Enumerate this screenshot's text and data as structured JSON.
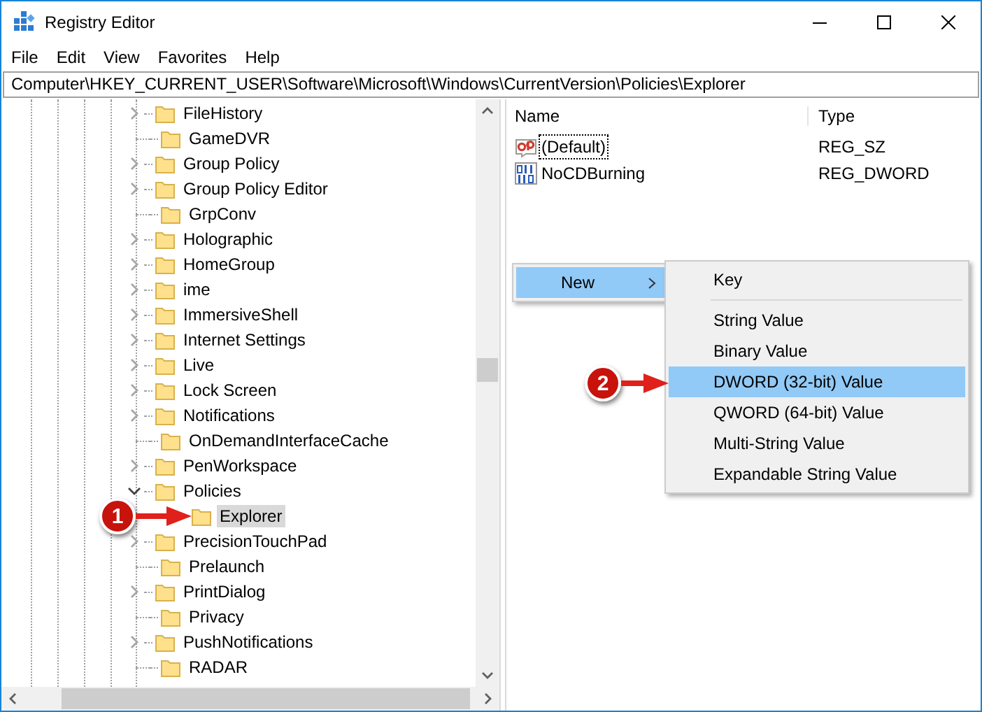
{
  "window": {
    "title": "Registry Editor"
  },
  "menu": [
    "File",
    "Edit",
    "View",
    "Favorites",
    "Help"
  ],
  "address": "Computer\\HKEY_CURRENT_USER\\Software\\Microsoft\\Windows\\CurrentVersion\\Policies\\Explorer",
  "tree": [
    {
      "name": "FileHistory",
      "has_children": true,
      "expanded": false,
      "selected": false
    },
    {
      "name": "GameDVR",
      "has_children": false,
      "expanded": false,
      "selected": false
    },
    {
      "name": "Group Policy",
      "has_children": true,
      "expanded": false,
      "selected": false
    },
    {
      "name": "Group Policy Editor",
      "has_children": true,
      "expanded": false,
      "selected": false
    },
    {
      "name": "GrpConv",
      "has_children": false,
      "expanded": false,
      "selected": false
    },
    {
      "name": "Holographic",
      "has_children": true,
      "expanded": false,
      "selected": false
    },
    {
      "name": "HomeGroup",
      "has_children": true,
      "expanded": false,
      "selected": false
    },
    {
      "name": "ime",
      "has_children": true,
      "expanded": false,
      "selected": false
    },
    {
      "name": "ImmersiveShell",
      "has_children": true,
      "expanded": false,
      "selected": false
    },
    {
      "name": "Internet Settings",
      "has_children": true,
      "expanded": false,
      "selected": false
    },
    {
      "name": "Live",
      "has_children": true,
      "expanded": false,
      "selected": false
    },
    {
      "name": "Lock Screen",
      "has_children": true,
      "expanded": false,
      "selected": false
    },
    {
      "name": "Notifications",
      "has_children": true,
      "expanded": false,
      "selected": false
    },
    {
      "name": "OnDemandInterfaceCache",
      "has_children": false,
      "expanded": false,
      "selected": false
    },
    {
      "name": "PenWorkspace",
      "has_children": true,
      "expanded": false,
      "selected": false
    },
    {
      "name": "Policies",
      "has_children": true,
      "expanded": true,
      "selected": false,
      "children": [
        {
          "name": "Explorer",
          "has_children": false,
          "expanded": false,
          "selected": true,
          "marker": "1"
        }
      ]
    },
    {
      "name": "PrecisionTouchPad",
      "has_children": true,
      "expanded": false,
      "selected": false
    },
    {
      "name": "Prelaunch",
      "has_children": false,
      "expanded": false,
      "selected": false
    },
    {
      "name": "PrintDialog",
      "has_children": true,
      "expanded": false,
      "selected": false
    },
    {
      "name": "Privacy",
      "has_children": false,
      "expanded": false,
      "selected": false
    },
    {
      "name": "PushNotifications",
      "has_children": true,
      "expanded": false,
      "selected": false
    },
    {
      "name": "RADAR",
      "has_children": false,
      "expanded": false,
      "selected": false
    }
  ],
  "values": {
    "columns": [
      "Name",
      "Type"
    ],
    "rows": [
      {
        "name": "(Default)",
        "type": "REG_SZ",
        "kind": "string",
        "focused": true
      },
      {
        "name": "NoCDBurning",
        "type": "REG_DWORD",
        "kind": "dword",
        "focused": false
      }
    ]
  },
  "context_menu": {
    "items": [
      {
        "label": "New",
        "has_submenu": true,
        "selected": true
      }
    ],
    "submenu": [
      {
        "label": "Key",
        "selected": false,
        "separator_after": true
      },
      {
        "label": "String Value",
        "selected": false,
        "separator_after": false
      },
      {
        "label": "Binary Value",
        "selected": false,
        "separator_after": false
      },
      {
        "label": "DWORD (32-bit) Value",
        "selected": true,
        "separator_after": false,
        "marker": "2"
      },
      {
        "label": "QWORD (64-bit) Value",
        "selected": false,
        "separator_after": false
      },
      {
        "label": "Multi-String Value",
        "selected": false,
        "separator_after": false
      },
      {
        "label": "Expandable String Value",
        "selected": false,
        "separator_after": false
      }
    ]
  }
}
